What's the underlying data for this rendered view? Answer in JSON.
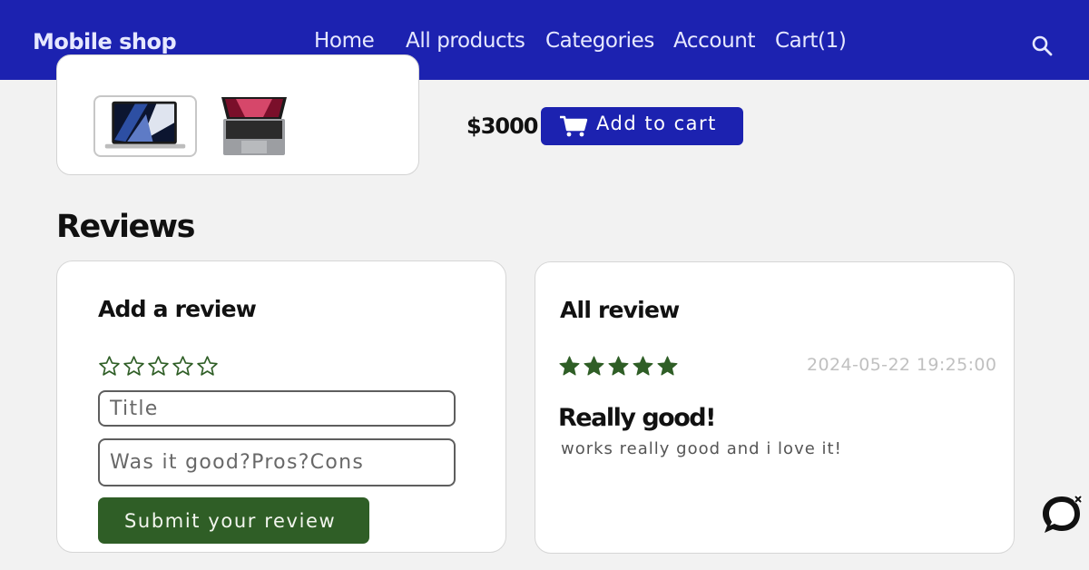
{
  "nav": {
    "brand": "Mobile shop",
    "links": [
      "Home",
      "All products",
      "Categories",
      "Account",
      "Cart(1)"
    ],
    "search_icon": "search-icon"
  },
  "product": {
    "price": "$3000",
    "add_to_cart": "Add to cart",
    "cart_icon": "shopping-cart-icon"
  },
  "reviews": {
    "heading": "Reviews",
    "add": {
      "title": "Add a review",
      "rating": 0,
      "title_placeholder": "Title",
      "body_placeholder": "Was it good?Pros?Cons",
      "submit": "Submit your review"
    },
    "all": {
      "title": "All review",
      "items": [
        {
          "rating": 5,
          "date": "2024-05-22 19:25:00",
          "title": "Really good!",
          "body": "works really good and i love it!"
        }
      ]
    }
  },
  "colors": {
    "nav": "#1c22b0",
    "accent": "#1c22b0",
    "star": "#2f5e26",
    "submit": "#2f5e26"
  },
  "chat_icon": "chat-bubble-icon"
}
